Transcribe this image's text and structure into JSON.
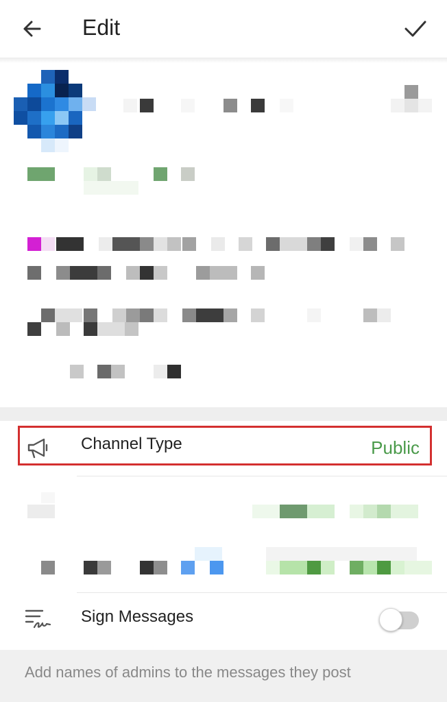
{
  "appbar": {
    "title": "Edit",
    "back_icon": "arrow-back-icon",
    "confirm_icon": "check-icon"
  },
  "channel_type": {
    "icon": "megaphone-icon",
    "label": "Channel Type",
    "value": "Public",
    "value_color": "#4a9a4a",
    "highlight_color": "#d32f2f"
  },
  "sign_messages": {
    "icon": "signature-icon",
    "label": "Sign Messages",
    "enabled": false
  },
  "footer": {
    "hint": "Add names of admins to the messages they post"
  }
}
